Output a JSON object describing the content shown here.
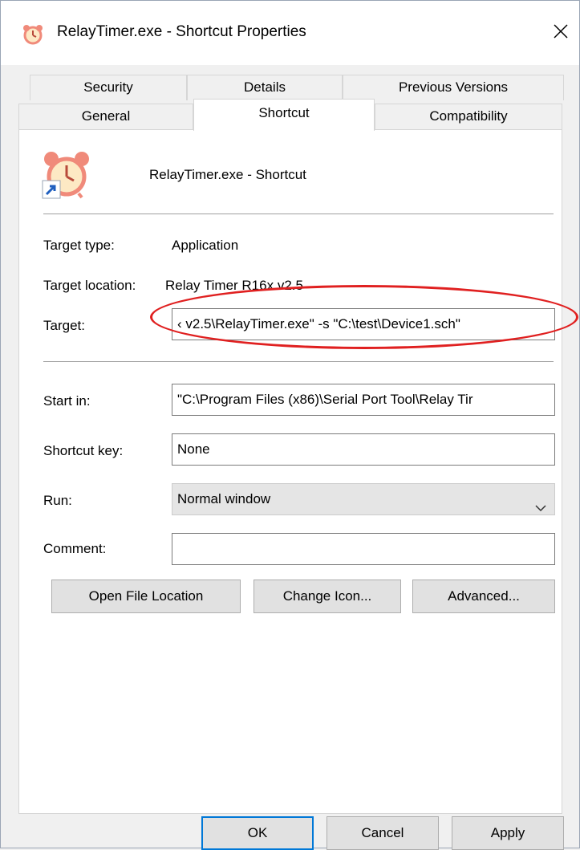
{
  "window": {
    "title": "RelayTimer.exe - Shortcut Properties"
  },
  "tabs": {
    "row1": [
      {
        "label": "Security"
      },
      {
        "label": "Details"
      },
      {
        "label": "Previous Versions"
      }
    ],
    "row2": [
      {
        "label": "General"
      },
      {
        "label": "Shortcut"
      },
      {
        "label": "Compatibility"
      }
    ],
    "active": "Shortcut"
  },
  "shortcut": {
    "name": "RelayTimer.exe - Shortcut",
    "target_type_label": "Target type:",
    "target_type_value": "Application",
    "target_location_label": "Target location:",
    "target_location_value": "Relay Timer R16x v2.5",
    "target_label": "Target:",
    "target_value": "‹ v2.5\\RelayTimer.exe\" -s \"C:\\test\\Device1.sch\"",
    "start_in_label": "Start in:",
    "start_in_value": "\"C:\\Program Files (x86)\\Serial Port Tool\\Relay Tir",
    "shortcut_key_label": "Shortcut key:",
    "shortcut_key_value": "None",
    "run_label": "Run:",
    "run_value": "Normal window",
    "comment_label": "Comment:",
    "comment_value": ""
  },
  "actions": {
    "open_file_location": "Open File Location",
    "change_icon": "Change Icon...",
    "advanced": "Advanced..."
  },
  "footer": {
    "ok": "OK",
    "cancel": "Cancel",
    "apply": "Apply"
  },
  "colors": {
    "annotation": "#e02020",
    "default_button_border": "#0078d7",
    "icon_accent": "#f08a7a"
  },
  "icons": {
    "title": "alarm-clock-icon",
    "shortcut": "alarm-clock-icon",
    "overlay": "shortcut-arrow-icon",
    "close": "close-icon",
    "dropdown": "chevron-down-icon"
  }
}
